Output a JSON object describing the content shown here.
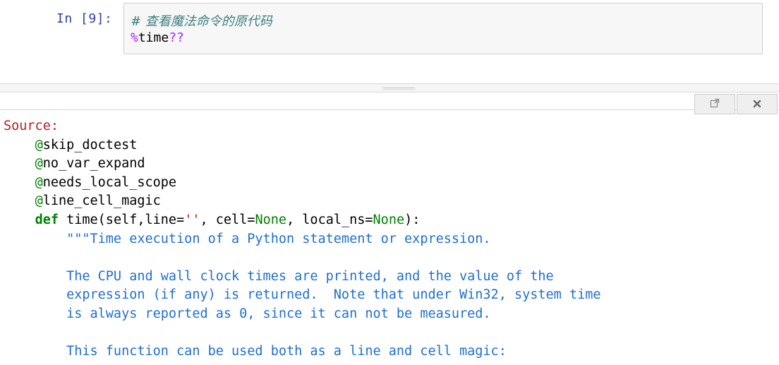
{
  "cell": {
    "prompt": "In  [9]:",
    "comment": "# 查看魔法命令的原代码",
    "magic_percent": "%",
    "magic_name": "time",
    "magic_suffix": "??"
  },
  "pager": {
    "source_label": "Source:",
    "decorators": [
      "skip_doctest",
      "no_var_expand",
      "needs_local_scope",
      "line_cell_magic"
    ],
    "def_keyword": "def",
    "func_signature_prefix": " time(self,line=",
    "default_str": "''",
    "sig_mid1": ", cell=",
    "none1": "None",
    "sig_mid2": ", local_ns=",
    "none2": "None",
    "sig_end": "):",
    "doc_lines": [
      "\"\"\"Time execution of a Python statement or expression.",
      "",
      "The CPU and wall clock times are printed, and the value of the",
      "expression (if any) is returned.  Note that under Win32, system time",
      "is always reported as 0, since it can not be measured.",
      "",
      "This function can be used both as a line and cell magic:"
    ]
  },
  "icons": {
    "expand": "expand-icon",
    "close": "close-icon"
  },
  "colors": {
    "prompt": "#303f9f",
    "comment": "#408080",
    "magic": "#aa22ff",
    "keyword": "#008000",
    "docstring": "#1f6fd1",
    "source_label": "#b22222"
  }
}
